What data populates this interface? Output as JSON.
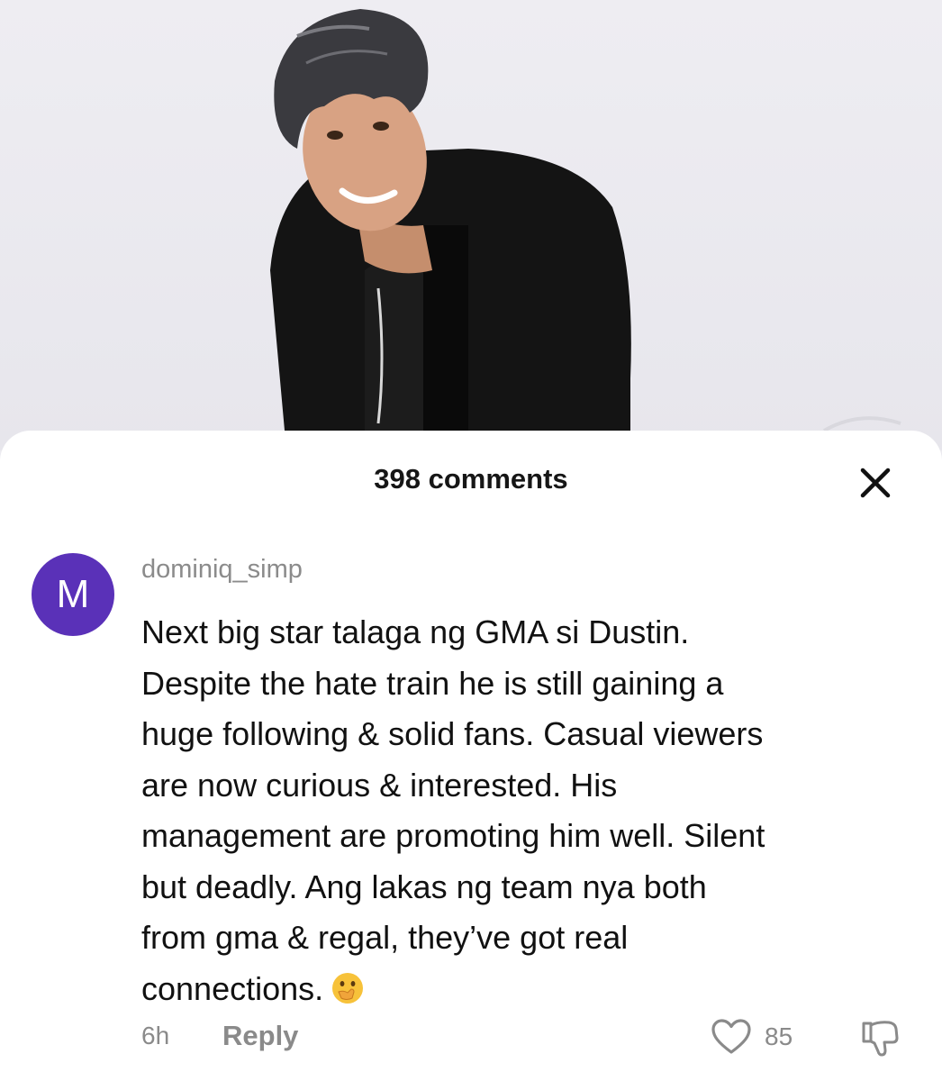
{
  "photo": {
    "alt_subject": "man in black jacket smiling"
  },
  "comments_panel": {
    "title": "398 comments",
    "close_icon": "close-icon"
  },
  "comment": {
    "avatar_letter": "M",
    "avatar_color": "#5a31b8",
    "username": "dominiq_simp",
    "lines": [
      "Next big star talaga ng GMA si Dustin.",
      "Despite the hate train he is still gaining a",
      "huge following & solid fans. Casual viewers",
      "are now curious & interested. His",
      "management are promoting him well. Silent",
      "but deadly. Ang lakas ng team nya both",
      "from gma & regal, they’ve got real",
      "connections."
    ],
    "emoji_icon": "face-with-hand-over-mouth-icon",
    "time": "6h",
    "reply_label": "Reply",
    "like_icon": "heart-icon",
    "like_count": "85",
    "dislike_icon": "thumbs-down-icon"
  }
}
